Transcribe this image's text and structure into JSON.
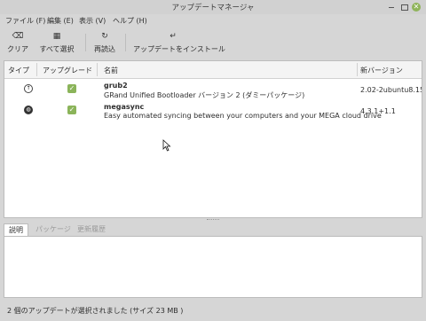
{
  "window": {
    "title": "アップデートマネージャ"
  },
  "menubar": [
    "ファイル (F)",
    "編集 (E)",
    "表示 (V)",
    "ヘルプ (H)"
  ],
  "toolbar": {
    "clear_label": "クリア",
    "select_all_label": "すべて選択",
    "refresh_label": "再読込",
    "install_label": "アップデートをインストール"
  },
  "columns": {
    "type": "タイプ",
    "upgrade": "アップグレード",
    "name": "名前",
    "new_version": "新バージョン"
  },
  "updates": [
    {
      "type_icon": "package-icon",
      "checked": true,
      "name": "grub2",
      "description": "GRand Unified Bootloader バージョン 2 (ダミーパッケージ)",
      "version": "2.02-2ubuntu8.15"
    },
    {
      "type_icon": "globe-icon",
      "checked": true,
      "name": "megasync",
      "description": "Easy automated syncing between your computers and your MEGA cloud drive",
      "version": "4.3.1+1.1"
    }
  ],
  "detail_tabs": [
    "説明",
    "パッケージ",
    "更新履歴"
  ],
  "status": "2 個のアップデートが選択されました (サイズ 23 MB )",
  "colors": {
    "accent": "#8bb45a",
    "background": "#d6d6d6",
    "list_background": "#ffffff"
  }
}
